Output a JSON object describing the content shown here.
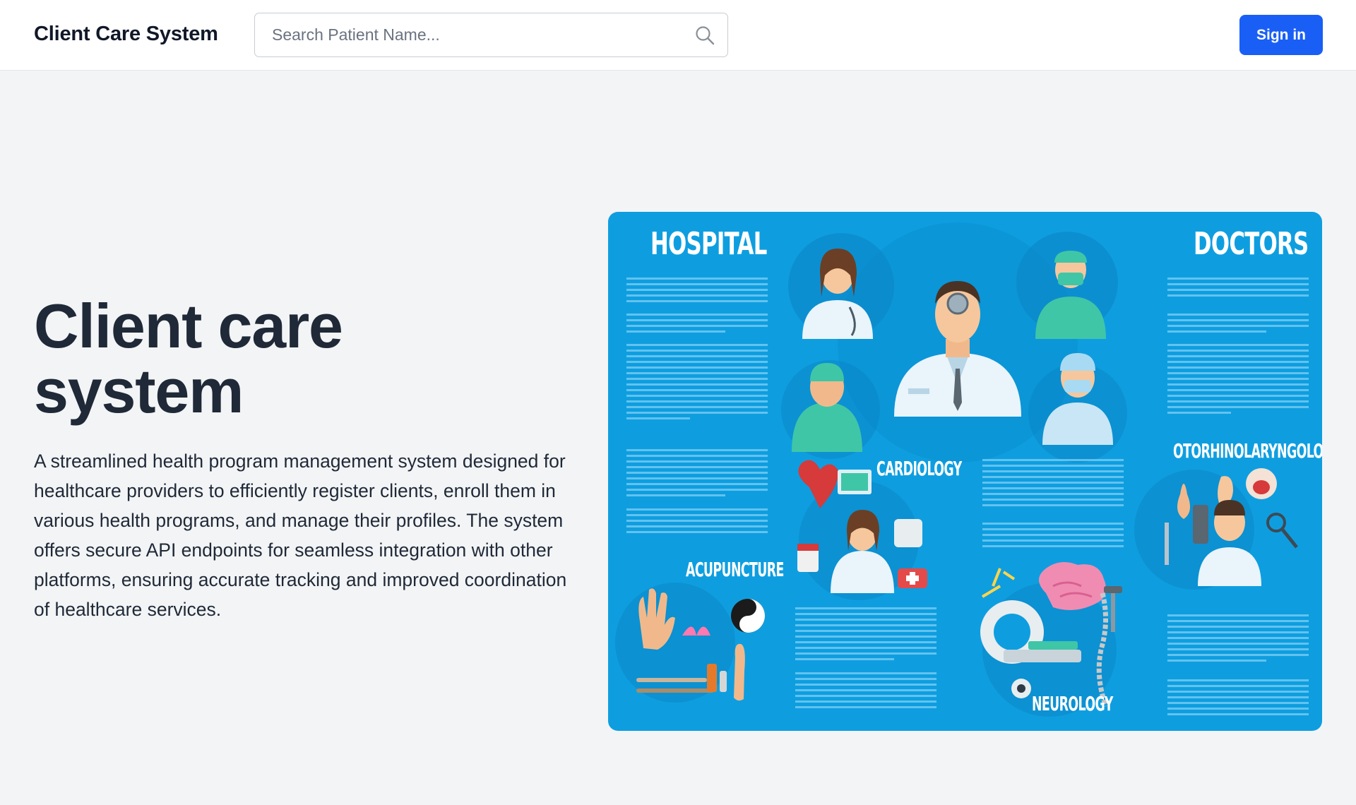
{
  "header": {
    "brand": "Client Care System",
    "search_placeholder": "Search Patient Name...",
    "signin_label": "Sign in"
  },
  "hero": {
    "title": "Client care system",
    "description": "A streamlined health program management system designed for healthcare providers to efficiently register clients, enroll them in various health programs, and manage their profiles. The system offers secure API endpoints for seamless integration with other platforms, ensuring accurate tracking and improved coordination of healthcare services."
  },
  "poster": {
    "headings": {
      "hospital": "HOSPITAL",
      "doctors": "DOCTORS",
      "cardiology": "CARDIOLOGY",
      "otorhinolaryngology": "OTORHINOLARYNGOLOGY",
      "acupuncture": "ACUPUNCTURE",
      "neurology": "NEUROLOGY"
    }
  },
  "colors": {
    "accent": "#1a5ff5",
    "poster_bg": "#0e9ee0",
    "page_bg": "#f3f4f6"
  }
}
